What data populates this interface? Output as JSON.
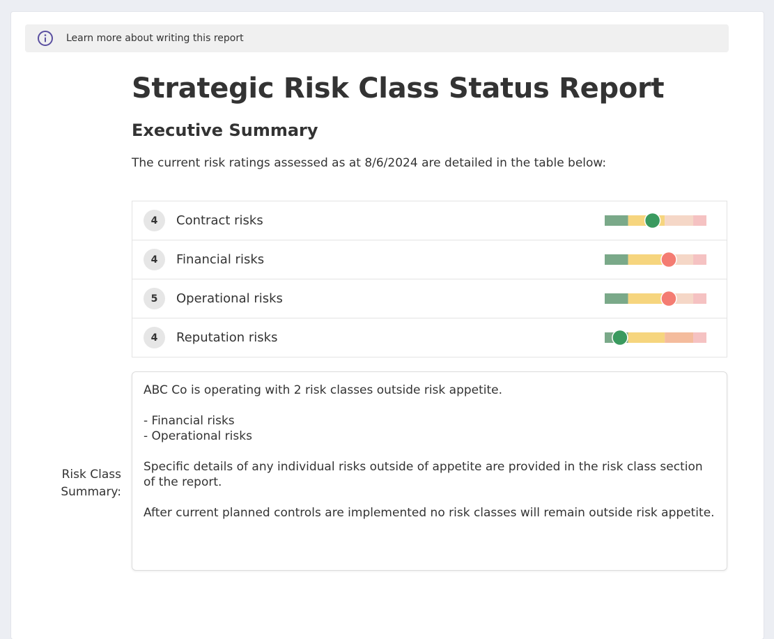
{
  "info_bar": {
    "text": "Learn more about writing this report",
    "icon": "info-circle-icon",
    "icon_color": "#5a4fa0"
  },
  "report": {
    "title": "Strategic Risk Class Status Report",
    "subtitle": "Executive Summary",
    "intro": "The current risk ratings assessed as at 8/6/2024 are detailed in the table below:"
  },
  "gauge_colors": {
    "green": "#7aa989",
    "yellow": "#f6d57e",
    "peach": "#f4bc9d",
    "peach_faded": "#f5d7c7",
    "pink": "#f5c2c2",
    "dot_in_appetite": "#3a9a5f",
    "dot_outside_appetite": "#f47c72"
  },
  "risks": [
    {
      "count": "4",
      "label": "Contract risks",
      "gauge_position": 0.47,
      "status": "in-appetite",
      "appetite_limit": 0.59
    },
    {
      "count": "4",
      "label": "Financial risks",
      "gauge_position": 0.63,
      "status": "outside-appetite",
      "appetite_limit": 0.55
    },
    {
      "count": "5",
      "label": "Operational risks",
      "gauge_position": 0.63,
      "status": "outside-appetite",
      "appetite_limit": 0.55
    },
    {
      "count": "4",
      "label": "Reputation risks",
      "gauge_position": 0.15,
      "status": "in-appetite",
      "appetite_limit": 0.87
    }
  ],
  "summary": {
    "label": "Risk Class Summary:",
    "intro_line": "ABC Co is operating with 2 risk classes outside risk appetite.",
    "outside_list": [
      "- Financial risks",
      "- Operational risks"
    ],
    "details": "Specific details of any individual risks outside of appetite are provided in the risk class section of the report.",
    "after_controls": "After current planned controls are implemented no risk classes will remain outside risk appetite."
  }
}
